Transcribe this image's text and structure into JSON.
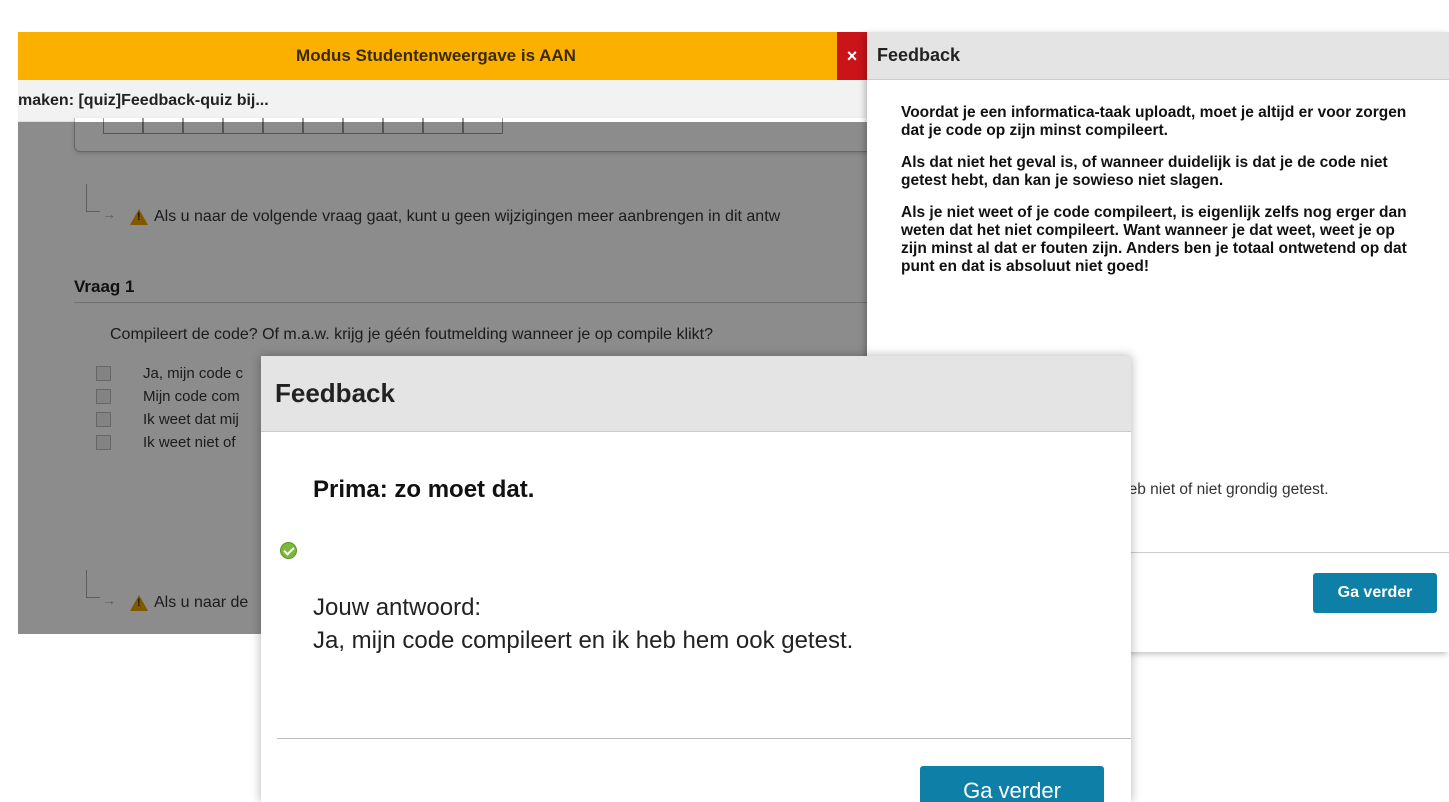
{
  "background_page": {
    "mode_banner": "Modus Studentenweergave is AAN",
    "breadcrumb": "maken: [quiz]Feedback-quiz bij...",
    "warning_text": "Als u naar de volgende vraag gaat, kunt u geen wijzigingen meer aanbrengen in dit antw",
    "warning_text_2": "Als u naar de",
    "question_title": "Vraag 1",
    "question_text": "Compileert de code? Of m.a.w. krijg je géén foutmelding wanneer je op compile klikt?",
    "options": [
      "Ja, mijn code c",
      "Mijn code com",
      "Ik weet dat mij",
      "Ik weet niet of"
    ]
  },
  "right_panel": {
    "close_label": "×",
    "title": "Feedback",
    "paragraphs": [
      "Voordat je een informatica-taak uploadt, moet je altijd er voor zorgen dat je code op zijn minst compileert.",
      "Als dat niet het geval is, of wanneer duidelijk is dat je de code niet getest hebt, dan kan je sowieso niet slagen.",
      "Als je niet weet of je code compileert, is eigenlijk zelfs nog erger dan weten dat het niet compileert. Want wanneer je dat weet, weet je op zijn minst al dat er fouten zijn. Anders ben je totaal ontwetend op dat punt en dat is absoluut niet goed!"
    ],
    "answer_tail": "r ik heb niet of niet grondig getest.",
    "button_label": "Ga verder"
  },
  "modal": {
    "title": "Feedback",
    "headline": "Prima: zo moet dat.",
    "answer_label": "Jouw antwoord:",
    "answer_value": "Ja, mijn code compileert en ik heb hem ook getest.",
    "button_label": "Ga verder"
  },
  "colors": {
    "banner": "#fbb000",
    "close": "#c9141a",
    "button": "#0e7fa6",
    "check": "#7cb83a"
  }
}
